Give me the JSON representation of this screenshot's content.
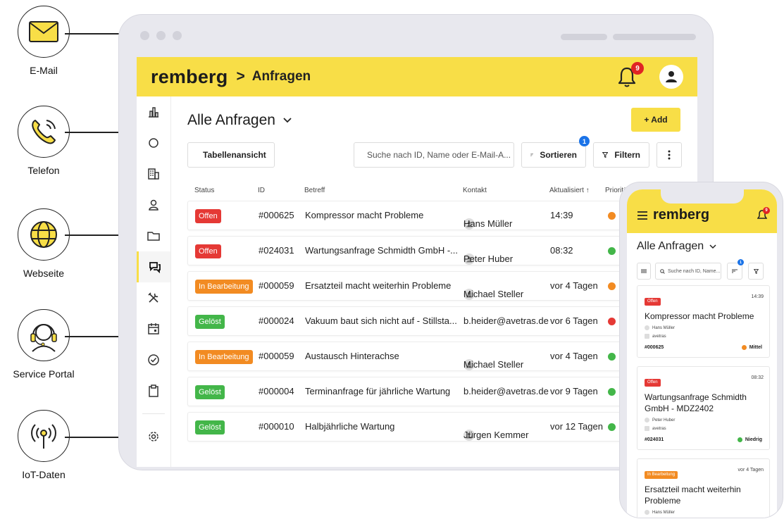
{
  "colors": {
    "brand_yellow": "#f8de47",
    "status_offen": "#e53935",
    "status_bearbeitung": "#f28b22",
    "status_geloest": "#43b649",
    "prio_orange": "#f28b22",
    "prio_green": "#43b649",
    "prio_red": "#e53935",
    "badge_red": "#e02424",
    "badge_blue": "#1a73e8"
  },
  "channels": [
    {
      "label": "E-Mail",
      "icon": "envelope-icon"
    },
    {
      "label": "Telefon",
      "icon": "phone-icon"
    },
    {
      "label": "Webseite",
      "icon": "globe-icon"
    },
    {
      "label": "Service Portal",
      "icon": "headset-icon"
    },
    {
      "label": "IoT-Daten",
      "icon": "antenna-icon"
    }
  ],
  "app": {
    "logo": "remberg",
    "breadcrumb_sep": ">",
    "breadcrumb": "Anfragen",
    "notification_count": "9"
  },
  "sidebar": {
    "items": [
      "chart-icon",
      "circle-icon",
      "building-icon",
      "person-icon",
      "folder-icon",
      "requests-icon",
      "tools-icon",
      "calendar-icon",
      "check-circle-icon",
      "clipboard-icon",
      "settings-icon"
    ],
    "active": 5
  },
  "main": {
    "title": "Alle Anfragen",
    "add_label": "+ Add",
    "view_label": "Tabellenansicht",
    "search_placeholder": "Suche nach ID, Name oder E-Mail-A...",
    "sort_label": "Sortieren",
    "sort_badge": "1",
    "filter_label": "Filtern",
    "columns": [
      "Status",
      "ID",
      "Betreff",
      "Kontakt",
      "Aktualisiert ↑",
      "Prioritä"
    ],
    "rows": [
      {
        "status": "Offen",
        "status_kind": "offen",
        "id": "#000625",
        "subject": "Kompressor macht Probleme",
        "contact": "Hans Müller",
        "contact_avatar": true,
        "updated": "14:39",
        "prio": "orange",
        "prio_char": "I"
      },
      {
        "status": "Offen",
        "status_kind": "offen",
        "id": "#024031",
        "subject": "Wartungsanfrage Schmidth GmbH -...",
        "contact": "Peter Huber",
        "contact_avatar": true,
        "updated": "08:32",
        "prio": "green",
        "prio_char": "N"
      },
      {
        "status": "In Bearbeitung",
        "status_kind": "bearbeitung",
        "id": "#000059",
        "subject": "Ersatzteil macht weiterhin Probleme",
        "contact": "Michael Steller",
        "contact_avatar": true,
        "updated": "vor 4 Tagen",
        "prio": "orange",
        "prio_char": "Y"
      },
      {
        "status": "Gelöst",
        "status_kind": "geloest",
        "id": "#000024",
        "subject": "Vakuum baut sich nicht auf - Stillsta...",
        "contact": "b.heider@avetras.de",
        "contact_avatar": false,
        "updated": "vor 6 Tagen",
        "prio": "red",
        "prio_char": "N"
      },
      {
        "status": "In Bearbeitung",
        "status_kind": "bearbeitung",
        "id": "#000059",
        "subject": "Austausch Hinterachse",
        "contact": "Michael Steller",
        "contact_avatar": true,
        "updated": "vor 4 Tagen",
        "prio": "green",
        "prio_char": "N"
      },
      {
        "status": "Gelöst",
        "status_kind": "geloest",
        "id": "#000004",
        "subject": "Terminanfrage für jährliche Wartung",
        "contact": "b.heider@avetras.de",
        "contact_avatar": false,
        "updated": "vor 9 Tagen",
        "prio": "green",
        "prio_char": "N"
      },
      {
        "status": "Gelöst",
        "status_kind": "geloest",
        "id": "#000010",
        "subject": "Halbjährliche Wartung",
        "contact": "Jürgen Kemmer",
        "contact_avatar": true,
        "updated": "vor 12 Tagen",
        "prio": "green",
        "prio_char": "N"
      }
    ]
  },
  "mobile": {
    "logo": "remberg",
    "title": "Alle Anfragen",
    "search_placeholder": "Suche nach ID, Name...",
    "sort_badge": "1",
    "cards": [
      {
        "status": "Offen",
        "status_kind": "offen",
        "time": "14:39",
        "title": "Kompressor macht Probleme",
        "contact": "Hans Müller",
        "company": "avetras",
        "id": "#000625",
        "prio_label": "Mittel",
        "prio": "orange"
      },
      {
        "status": "Offen",
        "status_kind": "offen",
        "time": "08:32",
        "title": "Wartungsanfrage Schmidth GmbH - MDZ2402",
        "contact": "Peter Huber",
        "company": "avetras",
        "id": "#024031",
        "prio_label": "Niedrig",
        "prio": "green"
      },
      {
        "status": "In Bearbeitung",
        "status_kind": "bearbeitung",
        "time": "vor 4 Tagen",
        "title": "Ersatzteil macht weiterhin Probleme",
        "contact": "Hans Müller",
        "company": "",
        "id": "",
        "prio_label": "",
        "prio": ""
      }
    ]
  }
}
